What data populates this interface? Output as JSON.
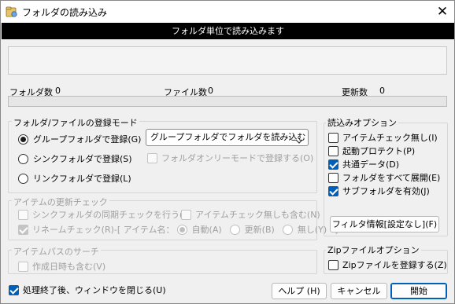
{
  "window": {
    "title": "フォルダの読み込み",
    "banner": "フォルダ単位で読み込みます"
  },
  "stats": {
    "folder_label": "フォルダ数",
    "folder_value": "0",
    "file_label": "ファイル数",
    "file_value": "0",
    "update_label": "更新数",
    "update_value": "0"
  },
  "progress": {
    "fraction": 0
  },
  "mode": {
    "group_label": "フォルダ/ファイルの登録モード",
    "opt_group": "グループフォルダで登録(G)",
    "opt_sync": "シンクフォルダで登録(S)",
    "opt_link": "リンクフォルダで登録(L)",
    "selected": "group",
    "combo_value": "グループフォルダでフォルダを読み込む",
    "folder_only": "フォルダオンリーモードで登録する(O)"
  },
  "update_check": {
    "group_label": "アイテムの更新チェック",
    "sync_check": "シンクフォルダの同期チェックを行う(K)",
    "item_nocheck": "アイテムチェック無しも含む(N)",
    "rename_check": "リネームチェック(R)-[ アイテム名：",
    "auto": "自動(A)",
    "update": "更新(B)",
    "none": "無し(Y)",
    "bracket_close": "]"
  },
  "path_search": {
    "group_label": "アイテムパスのサーチ",
    "include_created": "作成日時も含む(V)"
  },
  "read_options": {
    "group_label": "読込みオプション",
    "items": [
      {
        "label": "アイテムチェック無し(I)",
        "checked": false
      },
      {
        "label": "起動プロテクト(P)",
        "checked": false
      },
      {
        "label": "共通データ(D)",
        "checked": true
      },
      {
        "label": "フォルダをすべて展開(E)",
        "checked": false
      },
      {
        "label": "サブフォルダを有効(J)",
        "checked": true
      }
    ],
    "filter_button": "フィルタ情報[設定なし](F)"
  },
  "zip_options": {
    "group_label": "Zipファイルオプション",
    "register_zip": "Zipファイルを登録する(Z)"
  },
  "footer": {
    "close_after": "処理終了後、ウィンドウを閉じる(U)",
    "help": "ヘルプ (H)",
    "cancel": "キャンセル",
    "start": "開始"
  },
  "colors": {
    "accent": "#005fb8",
    "banner_bg": "#000000",
    "banner_fg": "#ffffff",
    "disabled_text": "#a0a0a0"
  },
  "icons": {
    "app": "folder-read-app-icon",
    "close": "close-icon",
    "combo": "chevron-down-icon"
  }
}
